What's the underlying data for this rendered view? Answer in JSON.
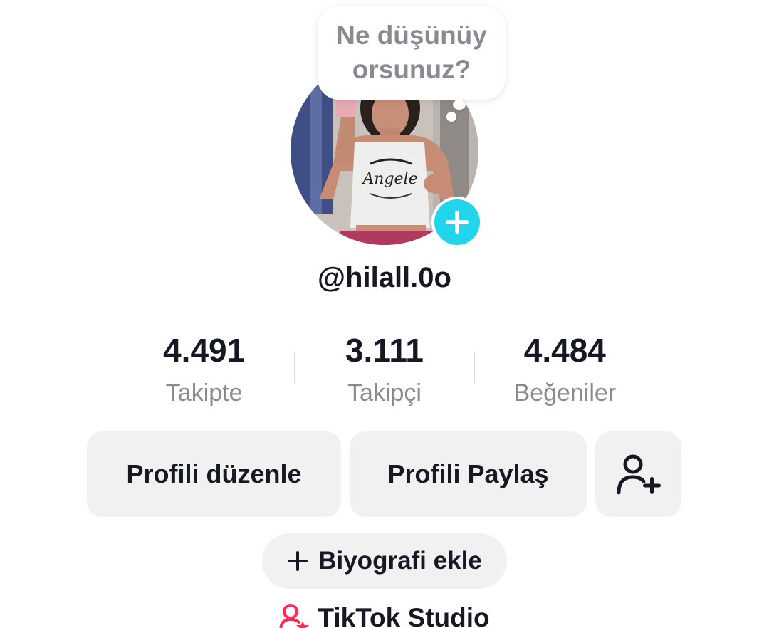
{
  "thought_bubble": {
    "text": "Ne düşünüy orsunuz?"
  },
  "avatar": {
    "icon": "profile-photo",
    "add_icon": "plus-icon",
    "add_color": "#20d5ec"
  },
  "profile": {
    "username": "@hilall.0o"
  },
  "stats": [
    {
      "value": "4.491",
      "label": "Takipte"
    },
    {
      "value": "3.111",
      "label": "Takipçi"
    },
    {
      "value": "4.484",
      "label": "Beğeniler"
    }
  ],
  "actions": {
    "edit_label": "Profili düzenle",
    "share_label": "Profili Paylaş",
    "add_friend_icon": "add-user-icon"
  },
  "bio": {
    "label": "Biyografi ekle",
    "icon": "plus-icon"
  },
  "studio": {
    "label": "TikTok Studio",
    "icon": "studio-user-icon",
    "icon_color": "#fe2c55"
  }
}
